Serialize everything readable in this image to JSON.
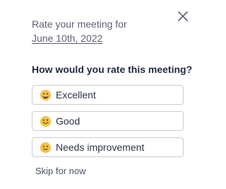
{
  "header": {
    "line1": "Rate your meeting for",
    "date": "June 10th, 2022"
  },
  "close": {
    "icon": "close-icon"
  },
  "question": "How would you rate this meeting?",
  "options": [
    {
      "label": "Excellent",
      "icon": "grinning-face-emoji"
    },
    {
      "label": "Good",
      "icon": "smiling-face-emoji"
    },
    {
      "label": "Needs improvement",
      "icon": "neutral-face-emoji"
    }
  ],
  "skip_label": "Skip for now",
  "colors": {
    "text_muted": "#5b6170",
    "text_heading": "#1f2a44",
    "border": "#c9ccd4",
    "emoji_fill": "#f6c443"
  }
}
